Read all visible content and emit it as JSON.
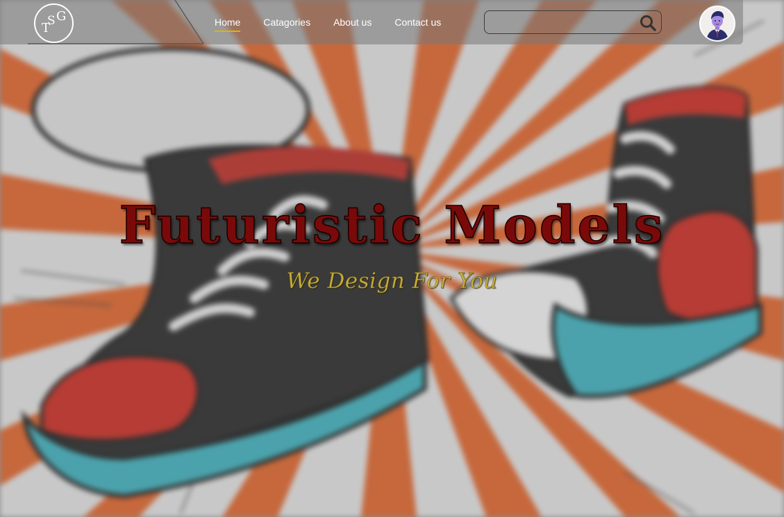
{
  "brand": {
    "logo_letters": [
      "T",
      "S",
      "G"
    ]
  },
  "nav": {
    "links": [
      {
        "label": "Home",
        "active": true
      },
      {
        "label": "Catagories",
        "active": false
      },
      {
        "label": "About us",
        "active": false
      },
      {
        "label": "Contact us",
        "active": false
      }
    ]
  },
  "search": {
    "value": "",
    "placeholder": "",
    "icon": "search-icon"
  },
  "user": {
    "avatar_icon": "user-avatar"
  },
  "hero": {
    "title": "Futuristic Models",
    "subtitle": "We Design For You"
  },
  "colors": {
    "accent_underline": "#e0b400",
    "title_color": "#7a0a0a",
    "subtitle_color": "#c7ae3a",
    "navbar_bg": "rgba(120,120,120,0.55)",
    "bg_orange": "#d8561a",
    "shoe_red": "#c21a10",
    "shoe_teal": "#2fa7b4"
  }
}
